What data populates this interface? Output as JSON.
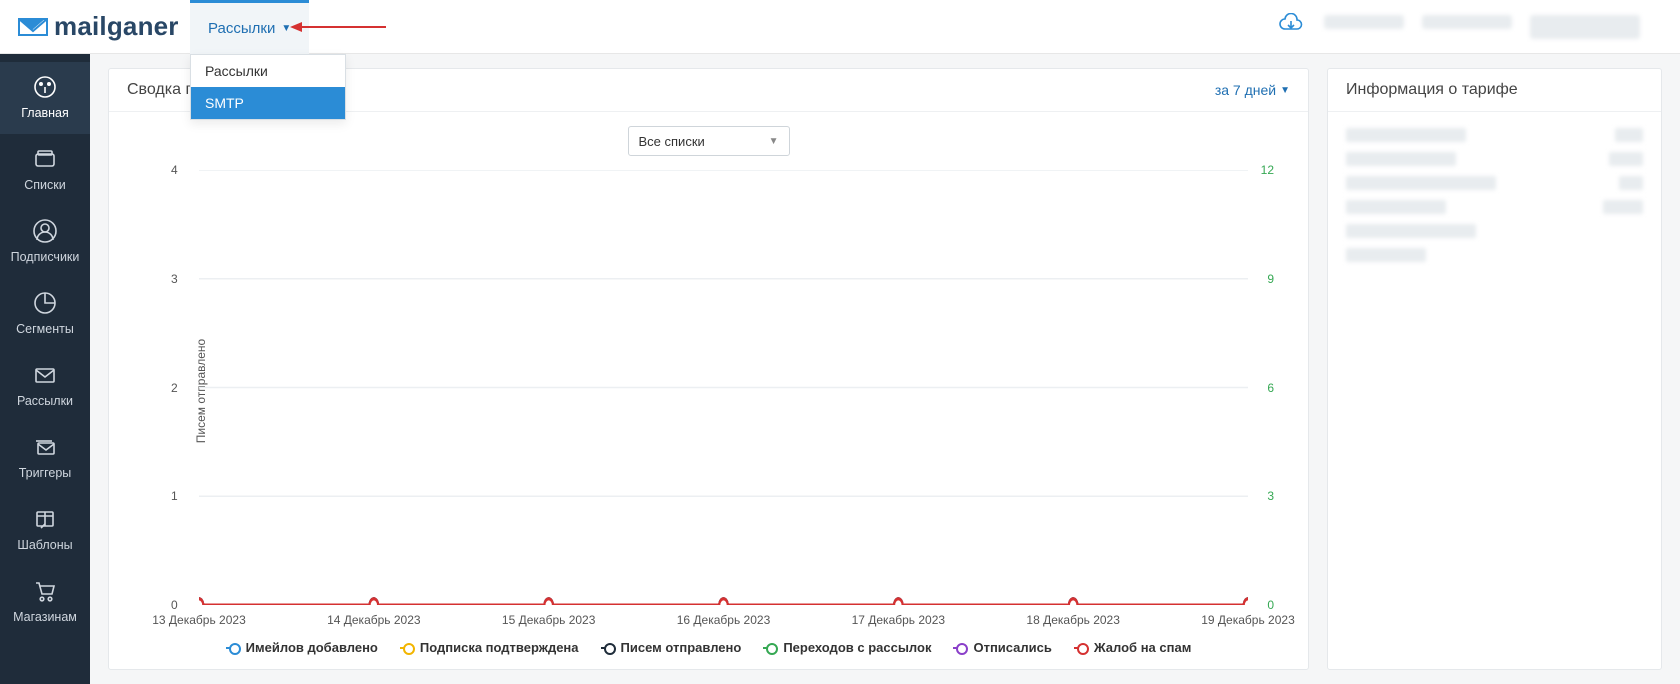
{
  "app": {
    "name": "mailganer"
  },
  "top_menu": {
    "tab_label": "Рассылки",
    "dropdown": [
      {
        "label": "Рассылки",
        "selected": false
      },
      {
        "label": "SMTP",
        "selected": true
      }
    ]
  },
  "sidebar": {
    "items": [
      {
        "id": "home",
        "label": "Главная",
        "icon": "dashboard-icon",
        "active": true
      },
      {
        "id": "lists",
        "label": "Списки",
        "icon": "wallet-icon",
        "active": false
      },
      {
        "id": "subscribers",
        "label": "Подписчики",
        "icon": "user-icon",
        "active": false
      },
      {
        "id": "segments",
        "label": "Сегменты",
        "icon": "pie-icon",
        "active": false
      },
      {
        "id": "campaigns",
        "label": "Рассылки",
        "icon": "mail-icon",
        "active": false
      },
      {
        "id": "triggers",
        "label": "Триггеры",
        "icon": "mails-icon",
        "active": false
      },
      {
        "id": "templates",
        "label": "Шаблоны",
        "icon": "template-icon",
        "active": false
      },
      {
        "id": "shops",
        "label": "Магазинам",
        "icon": "cart-icon",
        "active": false
      }
    ]
  },
  "summary_panel": {
    "title": "Сводка по а",
    "period_label": "за 7 дней",
    "list_select_label": "Все списки",
    "y_axis_left_label": "Писем отправлено"
  },
  "tariff_panel": {
    "title": "Информация о тарифе"
  },
  "chart_data": {
    "type": "line",
    "x": [
      "13 Декабрь 2023",
      "14 Декабрь 2023",
      "15 Декабрь 2023",
      "16 Декабрь 2023",
      "17 Декабрь 2023",
      "18 Декабрь 2023",
      "19 Декабрь 2023"
    ],
    "y_left_ticks": [
      0,
      1,
      2,
      3,
      4
    ],
    "y_right_ticks": [
      0,
      3,
      6,
      9,
      12
    ],
    "ylim_left": [
      0,
      4
    ],
    "ylim_right": [
      0,
      12
    ],
    "ylabel_left": "Писем отправлено",
    "series": [
      {
        "name": "Имейлов добавлено",
        "color": "#2b8cd6",
        "axis": "right",
        "values": [
          0,
          0,
          0,
          0,
          0,
          0,
          0
        ]
      },
      {
        "name": "Подписка подтверждена",
        "color": "#f2b500",
        "axis": "right",
        "values": [
          0,
          0,
          0,
          0,
          0,
          0,
          0
        ]
      },
      {
        "name": "Писем отправлено",
        "color": "#1f2c3a",
        "axis": "left",
        "values": [
          0,
          0,
          0,
          0,
          0,
          0,
          0
        ]
      },
      {
        "name": "Переходов с рассылок",
        "color": "#35a853",
        "axis": "right",
        "values": [
          0,
          0,
          0,
          0,
          0,
          0,
          0
        ]
      },
      {
        "name": "Отписались",
        "color": "#8a3fc9",
        "axis": "right",
        "values": [
          0,
          0,
          0,
          0,
          0,
          0,
          0
        ]
      },
      {
        "name": "Жалоб на спам",
        "color": "#d53131",
        "axis": "right",
        "values": [
          0,
          0,
          0,
          0,
          0,
          0,
          0
        ]
      }
    ]
  }
}
